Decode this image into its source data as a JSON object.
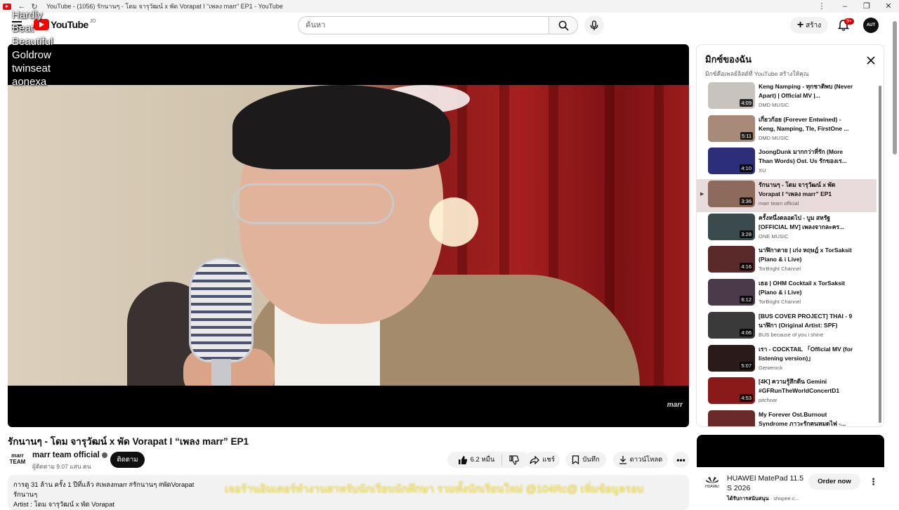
{
  "browser": {
    "tab_title": "YouTube - (1056) รักนานๆ - โดม จารุวัฒน์ x พัด Vorapat I “เพลง marr” EP1 - YouTube"
  },
  "overlay_text": [
    "Hardly",
    "Beat",
    "Beautiful",
    "Goldrow",
    "twinseat",
    "aonexa"
  ],
  "header": {
    "logo_text": "YouTube",
    "country_code": "JO",
    "search_placeholder": "ค้นหา",
    "create_label": "สร้าง",
    "notification_count": "9+",
    "avatar_text": "AUT"
  },
  "video": {
    "title": "รักนานๆ - โดม จารุวัฒน์ x พัด Vorapat I “เพลง marr” EP1",
    "watermark": "marr",
    "channel_logo": "marr TEAM",
    "channel_name": "marr team official",
    "subscribers": "ผู้ติดตาม 9.07 แสน คน",
    "follow_label": "ติดตาม",
    "likes": "6.2 หมื่น",
    "share_label": "แชร์",
    "save_label": "บันทึก",
    "download_label": "ดาวน์โหลด",
    "description_meta": "การดู 31 ล้าน ครั้ง  1 ปีที่แล้ว  #เพลงmarr #รักนานๆ #พัดVorapat",
    "description_line2": "รักนานๆ",
    "description_line3": "Artist : โดม จารุวัฒน์ x พัด Vorapat",
    "ticker": "เจอร้านอินเตอร์ทำงานสาหรับนักเรียนนักศึกษา รวมทั้งนักเรียนใหม่ @104Rc@ เพิ่มข้อมูลรอบ"
  },
  "playlist": {
    "title": "มิกซ์ของฉัน",
    "subtitle": "มิกซ์คือเพลย์ลิสต์ที่ YouTube สร้างให้คุณ",
    "items": [
      {
        "title": "Keng Namping - ทุกชาติพบ (Never Apart) | Official MV |...",
        "channel": "DMD MUSIC",
        "duration": "4:09",
        "color": "#c9c3c0"
      },
      {
        "title": "เกี่ยวก้อย (Forever Entwined) - Keng, Namping, Tle, FirstOne ...",
        "channel": "DMD MUSIC",
        "duration": "5:11",
        "color": "#a88a78"
      },
      {
        "title": "JoongDunk มากกว่าที่รัก (More Than Words) Ost. Us รักของเร...",
        "channel": "XU",
        "duration": "4:10",
        "color": "#2d2e7a"
      },
      {
        "title": "รักนานๆ - โดม จารุวัฒน์ x พัด Vorapat I “เพลง marr” EP1",
        "channel": "marr team official",
        "duration": "3:36",
        "color": "#8d6b5c"
      },
      {
        "title": "ครั้งหนึ่งตลอดไป - บูม สหรัฐ [OFFICIAL MV] เพลงจากละคร...",
        "channel": "ONE MUSIC",
        "duration": "3:28",
        "color": "#3b4a4e"
      },
      {
        "title": "นาฬิกาตาย | เก่ง หฤษฎ์ x TorSaksit (Piano & i Live)",
        "channel": "TorBright Channel",
        "duration": "4:16",
        "color": "#5a2a2a"
      },
      {
        "title": "เธอ | OHM Cocktail x TorSaksit (Piano & i Live)",
        "channel": "TorBright Channel",
        "duration": "6:12",
        "color": "#4a3a4a"
      },
      {
        "title": "[BUS COVER PROJECT] THAI - 9 นาฬิกา (Original Artist: SPF)",
        "channel": "BUS because of you i shine",
        "duration": "4:06",
        "color": "#3a3a3a"
      },
      {
        "title": "เรา - COCKTAIL 「Official MV (for listening version)」",
        "channel": "Genierock",
        "duration": "5:07",
        "color": "#2a1a1a"
      },
      {
        "title": "[4K] ความรู้สึกดีน Gemini #GFRunTheWorldConcertD1",
        "channel": "pitchoar",
        "duration": "4:53",
        "color": "#8a1a1a"
      },
      {
        "title": "My Forever Ost.Burnout Syndrome ภาวะรักคนหมดไฟ -...",
        "channel": "",
        "duration": "",
        "color": "#6a2a2a"
      }
    ],
    "active_index": 3
  },
  "ad": {
    "brand": "HUAWEI",
    "title": "HUAWEI MatePad 11.5 S 2026",
    "sponsor_label": "ได้รับการสนับสนุน",
    "sponsor_site": "shopee.c...",
    "order_label": "Order now"
  }
}
